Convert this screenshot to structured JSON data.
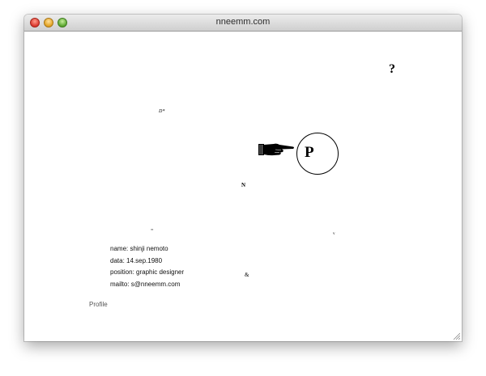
{
  "window": {
    "title": "nneemm.com"
  },
  "glyphs": {
    "question": "?",
    "d_star": "D*",
    "n": "N",
    "dash": "=",
    "v": "v",
    "at": "&"
  },
  "circle_button": {
    "letter": "P"
  },
  "profile": {
    "name": "name: shinji nemoto",
    "date": "data: 14.sep.1980",
    "position": "position: graphic designer",
    "mailto": "mailto: s@nneemm.com"
  },
  "footer": {
    "profile_link": "Profile"
  },
  "icons": {
    "pointer": "pointing-hand-icon",
    "resize": "resize-grip-icon"
  },
  "colors": {
    "background": "#ffffff",
    "text": "#111111",
    "link": "#555555"
  }
}
